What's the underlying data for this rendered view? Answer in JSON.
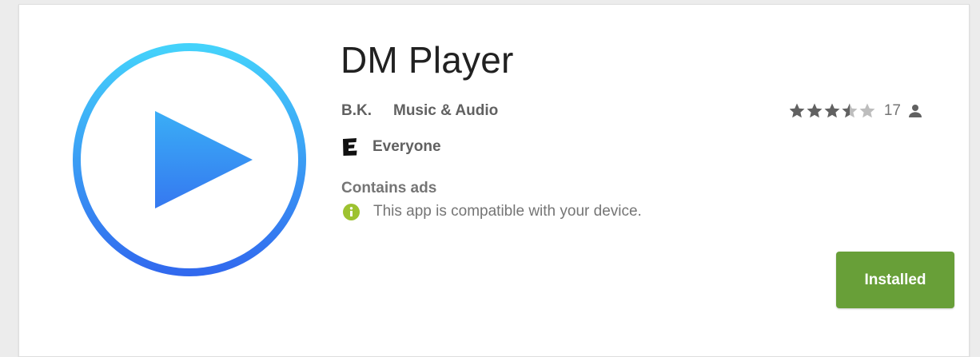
{
  "app": {
    "title": "DM Player",
    "developer": "B.K.",
    "category": "Music & Audio",
    "content_rating": "Everyone",
    "ads_note": "Contains ads",
    "compatibility": "This app is compatible with your device.",
    "install_button": "Installed"
  },
  "rating": {
    "stars": 3.5,
    "max_stars": 5,
    "count": "17"
  },
  "icons": {
    "app_icon": "play-circle-icon",
    "rating_stars": "star-icon",
    "reviewer": "person-icon",
    "content_rating": "esrb-e-icon",
    "compatibility": "info-icon"
  },
  "colors": {
    "install_button": "#689f38",
    "info_icon": "#9dc230",
    "icon_gradient_top": "#44d2fb",
    "icon_gradient_bottom": "#3169ee"
  }
}
